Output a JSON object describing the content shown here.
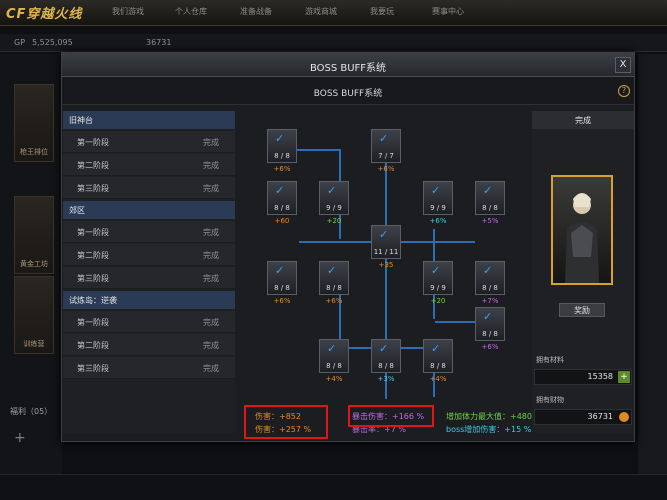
{
  "app": {
    "logo": "CF穿越火线"
  },
  "topnav": [
    "我们游戏",
    "个人仓库",
    "准备战备",
    "游戏商城",
    "我要玩",
    "赛事中心"
  ],
  "stats": {
    "money": "5,525,095",
    "points": "36731"
  },
  "sidebar": {
    "cards": [
      "枪王排位",
      "黄金工坊",
      "训练营"
    ],
    "bottom_label": "福利（05）"
  },
  "modal": {
    "title": "BOSS BUFF系统",
    "close_label": "X",
    "subtitle": "BOSS BUFF系统",
    "help_label": "?",
    "categories": [
      {
        "name": "旧神台",
        "stages": [
          {
            "name": "第一阶段",
            "status": "完成"
          },
          {
            "name": "第二阶段",
            "status": "完成"
          },
          {
            "name": "第三阶段",
            "status": "完成"
          }
        ]
      },
      {
        "name": "郊区",
        "stages": [
          {
            "name": "第一阶段",
            "status": "完成"
          },
          {
            "name": "第二阶段",
            "status": "完成"
          },
          {
            "name": "第三阶段",
            "status": "完成"
          }
        ]
      },
      {
        "name": "试炼岛：逆袭",
        "stages": [
          {
            "name": "第一阶段",
            "status": "完成"
          },
          {
            "name": "第二阶段",
            "status": "完成"
          },
          {
            "name": "第三阶段",
            "status": "完成"
          }
        ]
      }
    ],
    "nodes": [
      {
        "count": "8 / 8",
        "value": "+6%",
        "color": "o"
      },
      {
        "count": "7 / 7",
        "value": "+6%",
        "color": "o"
      },
      {
        "count": "8 / 8",
        "value": "+60",
        "color": "o"
      },
      {
        "count": "9 / 9",
        "value": "+20",
        "color": "g"
      },
      {
        "count": "9 / 9",
        "value": "+6%",
        "color": "c"
      },
      {
        "count": "8 / 8",
        "value": "+5%",
        "color": "p"
      },
      {
        "count": "11 / 11",
        "value": "+35",
        "color": "o"
      },
      {
        "count": "8 / 8",
        "value": "+6%",
        "color": "o"
      },
      {
        "count": "8 / 8",
        "value": "+6%",
        "color": "o"
      },
      {
        "count": "9 / 9",
        "value": "+20",
        "color": "g"
      },
      {
        "count": "8 / 8",
        "value": "+7%",
        "color": "p"
      },
      {
        "count": "8 / 8",
        "value": "+6%",
        "color": "p"
      },
      {
        "count": "8 / 8",
        "value": "+4%",
        "color": "o"
      },
      {
        "count": "8 / 8",
        "value": "+3%",
        "color": "c"
      },
      {
        "count": "8 / 8",
        "value": "+4%",
        "color": "o"
      }
    ],
    "right": {
      "header": "完成",
      "claim_label": "奖励",
      "materials_label": "拥有材料",
      "materials_value": "15358",
      "wealth_label": "拥有财物",
      "wealth_value": "36731"
    },
    "summary": {
      "line1a": "伤害：+852",
      "line1b": "暴击伤害：+166 %",
      "line1c": "增加体力最大值：+480",
      "line2a": "伤害：+257 %",
      "line2b": "暴击率：+7 %",
      "line2c": "boss增加伤害：+15 %"
    }
  },
  "colors": {
    "accent_blue": "#2b6db6",
    "highlight_red": "#e01616",
    "gold": "#d9a02c"
  }
}
